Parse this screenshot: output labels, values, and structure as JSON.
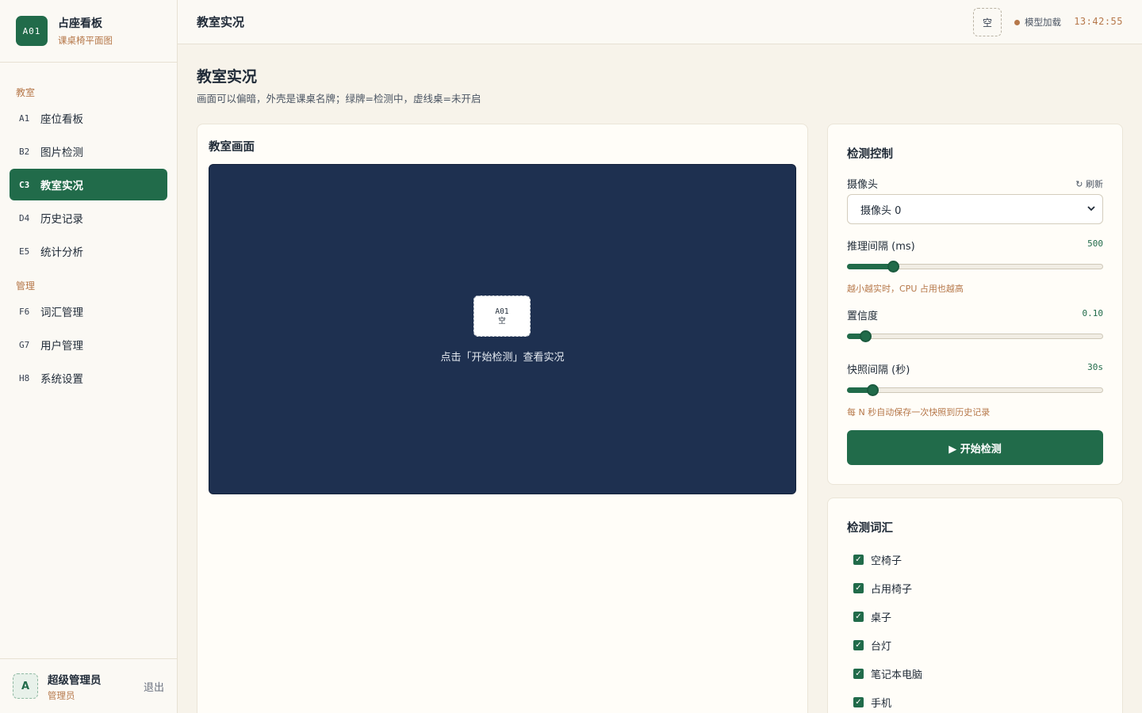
{
  "brand": {
    "logo": "A01",
    "title": "占座看板",
    "subtitle": "课桌椅平面图"
  },
  "sidebar": {
    "sections": [
      {
        "label": "教室"
      },
      {
        "label": "管理"
      }
    ],
    "items": [
      {
        "code": "A1",
        "label": "座位看板"
      },
      {
        "code": "B2",
        "label": "图片检测"
      },
      {
        "code": "C3",
        "label": "教室实况"
      },
      {
        "code": "D4",
        "label": "历史记录"
      },
      {
        "code": "E5",
        "label": "统计分析"
      },
      {
        "code": "F6",
        "label": "词汇管理"
      },
      {
        "code": "G7",
        "label": "用户管理"
      },
      {
        "code": "H8",
        "label": "系统设置"
      }
    ],
    "active_index": 2
  },
  "user": {
    "avatar": "A",
    "name": "超级管理员",
    "role": "管理员",
    "logout": "退出"
  },
  "topbar": {
    "title": "教室实况",
    "chip": "空",
    "status": "模型加载",
    "clock": "13:42:55"
  },
  "page": {
    "title": "教室实况",
    "subtitle": "画面可以偏暗，外壳是课桌名牌；绿牌=检测中，虚线桌=未开启"
  },
  "video": {
    "title": "教室画面",
    "seat_code": "A01",
    "seat_status": "空",
    "hint": "点击「开始检测」查看实况"
  },
  "control": {
    "title": "检测控制",
    "camera_label": "摄像头",
    "refresh": "↻ 刷新",
    "camera_value": "摄像头 0",
    "interval_label": "推理间隔 (ms)",
    "interval_value": "500",
    "interval_level": 0.18,
    "interval_hint": "越小越实时，CPU 占用也越高",
    "confidence_label": "置信度",
    "confidence_value": "0.10",
    "confidence_level": 0.07,
    "snapshot_label": "快照间隔 (秒)",
    "snapshot_value": "30s",
    "snapshot_level": 0.1,
    "snapshot_hint": "每 N 秒自动保存一次快照到历史记录",
    "start_label": "▶ 开始检测"
  },
  "vocab": {
    "title": "检测词汇",
    "items": [
      {
        "label": "空椅子",
        "checked": true
      },
      {
        "label": "占用椅子",
        "checked": true
      },
      {
        "label": "桌子",
        "checked": true
      },
      {
        "label": "台灯",
        "checked": true
      },
      {
        "label": "笔记本电脑",
        "checked": true
      },
      {
        "label": "手机",
        "checked": true
      }
    ]
  },
  "colors": {
    "primary": "#216b4a",
    "accent": "#b6784a",
    "video_bg": "#1e3050",
    "page_bg": "#f7f3ea"
  }
}
